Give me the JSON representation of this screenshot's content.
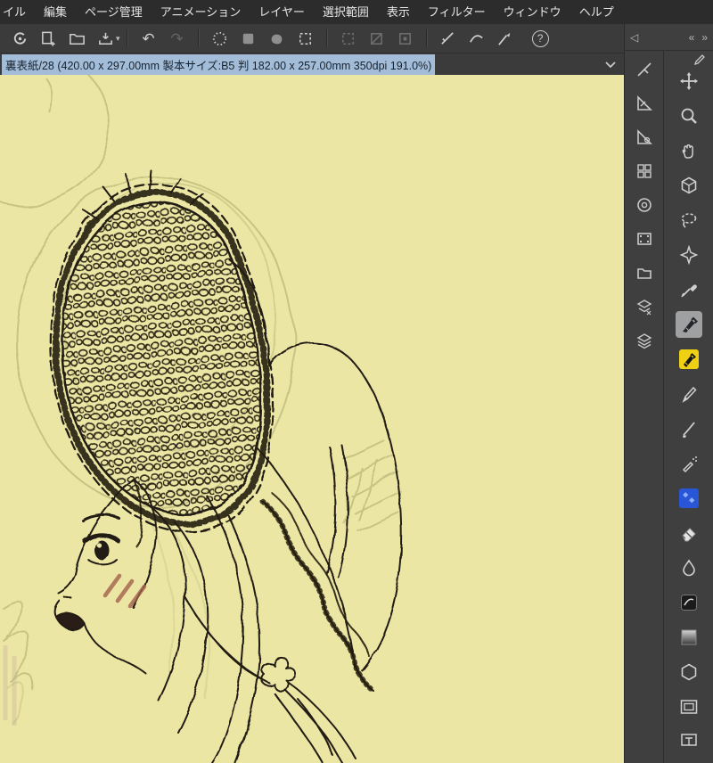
{
  "menubar": {
    "items": [
      "イル",
      "編集",
      "ページ管理",
      "アニメーション",
      "レイヤー",
      "選択範囲",
      "表示",
      "フィルター",
      "ウィンドウ",
      "ヘルプ"
    ]
  },
  "toolbar": {
    "buttons": [
      "clip-studio-logo",
      "new-page",
      "open-file",
      "save-file",
      "undo",
      "redo",
      "select-burst",
      "select-square",
      "select-blob",
      "crop-marks",
      "deselect-dashed",
      "deselect-diagonal",
      "deselect-outline",
      "snap-ruler",
      "snap-curve",
      "snap-pen",
      "help"
    ]
  },
  "icons": {
    "undo": "↶",
    "redo": "↷",
    "help": "?",
    "collapse_left": "◁",
    "dock_prev": "«",
    "dock_next": "»",
    "save_caret": "▾"
  },
  "infobar": {
    "text": "裏表紙/28 (420.00 x 297.00mm 製本サイズ:B5 判 182.00 x 257.00mm 350dpi 191.0%)"
  },
  "panels": {
    "dock_items": [
      "quick-access",
      "sub-tool-detail",
      "tool-property",
      "navigator",
      "sub-view",
      "timeline",
      "material",
      "layer-property",
      "layer"
    ],
    "tools": [
      "move",
      "zoom",
      "hand",
      "operation",
      "lasso",
      "auto-select",
      "eyedropper",
      "pen",
      "marker",
      "pencil",
      "brush",
      "airbrush",
      "decoration",
      "eraser",
      "blend",
      "fill",
      "gradient",
      "figure",
      "frame-border"
    ],
    "selected_tool": "pen"
  },
  "colors": {
    "canvas_paper": "#ece6a4",
    "selection_highlight": "#a3bdd8",
    "marker_yellow": "#f0d012",
    "decoration_blue": "#2856d6",
    "line_art": "#241c12",
    "sketch_olive": "#a3a464"
  }
}
